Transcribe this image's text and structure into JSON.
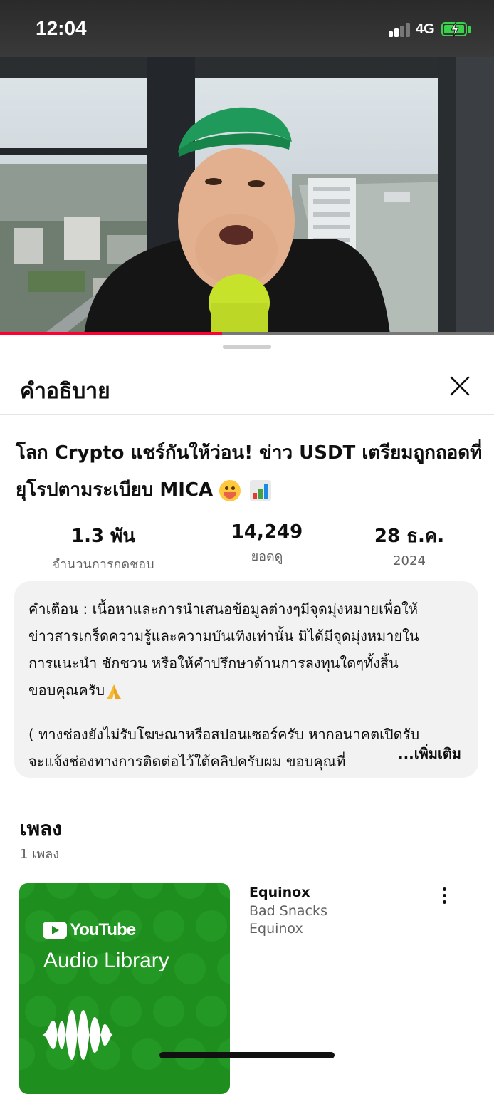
{
  "status_bar": {
    "time": "12:04",
    "network": "4G",
    "icons": [
      "signal-bars-icon",
      "battery-charging-icon"
    ]
  },
  "video": {
    "progress": 0.45,
    "progress_color": "#ff0033"
  },
  "sheet": {
    "title": "คำอธิบาย",
    "close_icon": "close-icon"
  },
  "video_info": {
    "title": "โลก Crypto แชร์กันให้ว่อน! ข่าว USDT เตรียมถูกถอดที่ยุโรปตามระเบียบ MICA",
    "title_emojis": [
      "flushed-face-emoji",
      "bar-chart-emoji"
    ]
  },
  "stats": [
    {
      "value": "1.3 พัน",
      "label": "จำนวนการกดชอบ"
    },
    {
      "value": "14,249",
      "label": "ยอดดู"
    },
    {
      "value": "28 ธ.ค.",
      "label": "2024"
    }
  ],
  "description": {
    "lines": [
      "คำเตือน : เนื้อหาและการนำเสนอข้อมูลต่างๆมีจุดมุ่งหมายเพื่อให้",
      "ข่าวสารเกร็ดความรู้และความบันเทิงเท่านั้น มิได้มีจุดมุ่งหมายใน",
      "การแนะนำ ชักชวน หรือให้คำปรึกษาด้านการลงทุนใดๆทั้งสิ้น",
      "ขอบคุณครับ",
      "( ทางช่องยังไม่รับโฆษณาหรือสปอนเซอร์ครับ หากอนาคตเปิดรับ",
      "จะแจ้งช่องทางการติดต่อไว้ใต้คลิปครับผม ขอบคุณที่"
    ],
    "more_label": "...เพิ่มเติม"
  },
  "music": {
    "heading": "เพลง",
    "count_label": "1 เพลง",
    "album_art": {
      "brand": "YouTube",
      "name": "Audio Library",
      "color": "#1e8f1e"
    },
    "track": {
      "title": "Equinox",
      "artist": "Bad Snacks",
      "album": "Equinox"
    }
  }
}
